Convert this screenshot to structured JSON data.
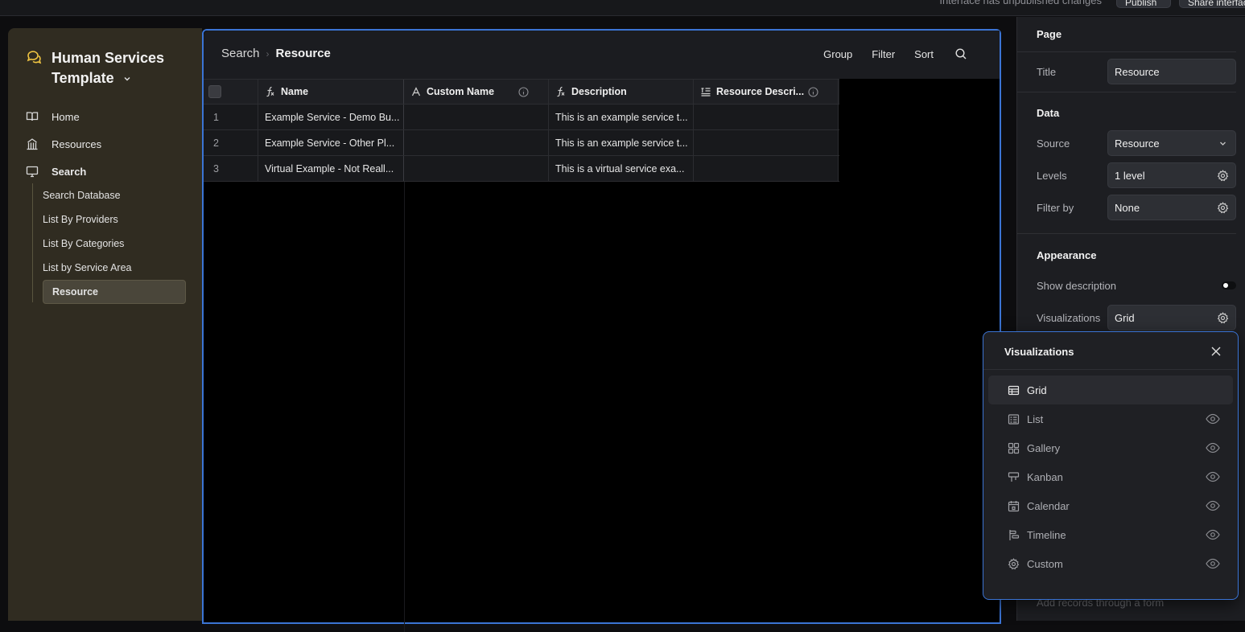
{
  "topbar": {
    "notice": "Interface has unpublished changes",
    "publish_label": "Publish",
    "share_label": "Share interface"
  },
  "sidebar": {
    "app_name": "Human Services Template",
    "nav": [
      {
        "label": "Home",
        "icon": "book-icon"
      },
      {
        "label": "Resources",
        "icon": "building-icon"
      },
      {
        "label": "Search",
        "icon": "monitor-icon"
      }
    ],
    "sub_items": [
      {
        "label": "Search Database"
      },
      {
        "label": "List By Providers"
      },
      {
        "label": "List By Categories"
      },
      {
        "label": "List by Service Area"
      },
      {
        "label": "Resource"
      }
    ]
  },
  "header": {
    "crumb_parent": "Search",
    "crumb_current": "Resource",
    "group_label": "Group",
    "filter_label": "Filter",
    "sort_label": "Sort"
  },
  "table": {
    "columns": [
      {
        "label": "Name",
        "icon": "formula-icon"
      },
      {
        "label": "Custom Name",
        "icon": "text-icon"
      },
      {
        "label": "Description",
        "icon": "formula-icon"
      },
      {
        "label": "Resource Descri...",
        "icon": "long-text-icon"
      }
    ],
    "rows": [
      {
        "index": "1",
        "name": "Example Service - Demo Bu...",
        "custom_name": "",
        "description": "This is an example service t...",
        "resource_description": ""
      },
      {
        "index": "2",
        "name": "Example Service - Other Pl...",
        "custom_name": "",
        "description": "This is an example service t...",
        "resource_description": ""
      },
      {
        "index": "3",
        "name": "Virtual Example - Not Reall...",
        "custom_name": "",
        "description": "This is a virtual service exa...",
        "resource_description": ""
      }
    ]
  },
  "panel": {
    "page_section": "Page",
    "title_label": "Title",
    "title_value": "Resource",
    "data_section": "Data",
    "source_label": "Source",
    "source_value": "Resource",
    "levels_label": "Levels",
    "levels_value": "1 level",
    "filter_label": "Filter by",
    "filter_value": "None",
    "appearance_section": "Appearance",
    "show_description_label": "Show description",
    "show_description_on": true,
    "visualizations_label": "Visualizations",
    "visualizations_value": "Grid",
    "add_records_label": "Add records through a form"
  },
  "popup": {
    "title": "Visualizations",
    "items": [
      {
        "label": "Grid",
        "icon": "grid-icon",
        "selected": true
      },
      {
        "label": "List",
        "icon": "list-icon"
      },
      {
        "label": "Gallery",
        "icon": "gallery-icon"
      },
      {
        "label": "Kanban",
        "icon": "kanban-icon"
      },
      {
        "label": "Calendar",
        "icon": "calendar-icon"
      },
      {
        "label": "Timeline",
        "icon": "timeline-icon"
      },
      {
        "label": "Custom",
        "icon": "custom-icon"
      }
    ]
  },
  "colors": {
    "accent": "#3b74d4",
    "sidebar_bg": "#302c21",
    "panel_bg": "#1d1e22"
  }
}
